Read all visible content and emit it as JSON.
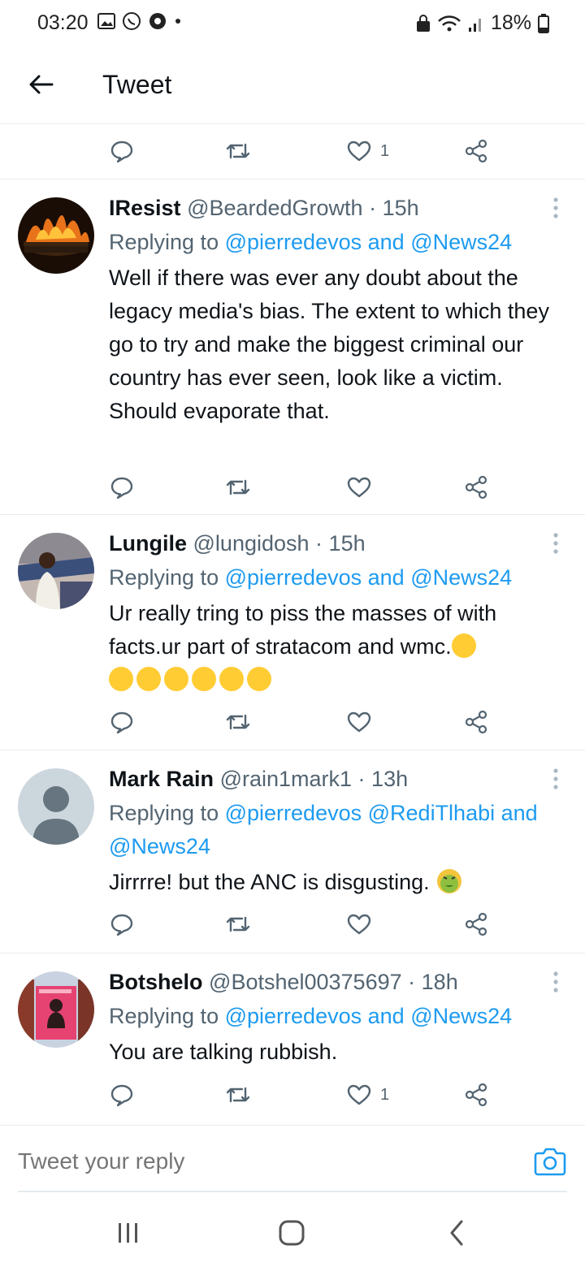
{
  "status_bar": {
    "time": "03:20",
    "battery": "18%"
  },
  "app_bar": {
    "title": "Tweet"
  },
  "top_actions": {
    "like_count": "1"
  },
  "tweets": [
    {
      "name": "IResist",
      "handle": "@BeardedGrowth",
      "time": "15h",
      "replying_prefix": "Replying to",
      "mention_1": "@pierredevos",
      "joiner": "and",
      "mention_2": "@News24",
      "text": "Well if there was ever any doubt about the legacy media's bias. The extent to which they go to try and make the biggest criminal our country has ever seen, look like a victim. Should evaporate that.",
      "like_count": ""
    },
    {
      "name": "Lungile",
      "handle": "@lungidosh",
      "time": "15h",
      "replying_prefix": "Replying to",
      "mention_1": "@pierredevos",
      "joiner": "and",
      "mention_2": "@News24",
      "text": "Ur really tring to piss the masses of with facts.ur part of stratacom and wmc.",
      "like_count": ""
    },
    {
      "name": "Mark Rain",
      "handle": "@rain1mark1",
      "time": "13h",
      "replying_prefix": "Replying to",
      "mention_1": "@pierredevos",
      "mention_extra": "@RediTlhabi",
      "joiner": "and",
      "mention_2": "@News24",
      "text": "Jirrrre! but the ANC is disgusting.",
      "like_count": ""
    },
    {
      "name": "Botshelo",
      "handle": "@Botshel00375697",
      "time": "18h",
      "replying_prefix": "Replying to",
      "mention_1": "@pierredevos",
      "joiner": "and",
      "mention_2": "@News24",
      "text": "You are talking rubbish.",
      "like_count": "1"
    }
  ],
  "composer": {
    "placeholder": "Tweet your reply"
  },
  "icons": {
    "back": "arrow-left-icon",
    "reply": "reply-bubble-icon",
    "retweet": "retweet-icon",
    "like": "heart-icon",
    "share": "share-icon",
    "more": "more-vertical-icon",
    "camera": "camera-icon",
    "nav_recents": "recents-icon",
    "nav_home": "home-icon",
    "nav_back": "nav-back-icon"
  },
  "colors": {
    "accent": "#1d9bf0",
    "secondary_text": "#536471",
    "divider": "#e6ecf0"
  }
}
